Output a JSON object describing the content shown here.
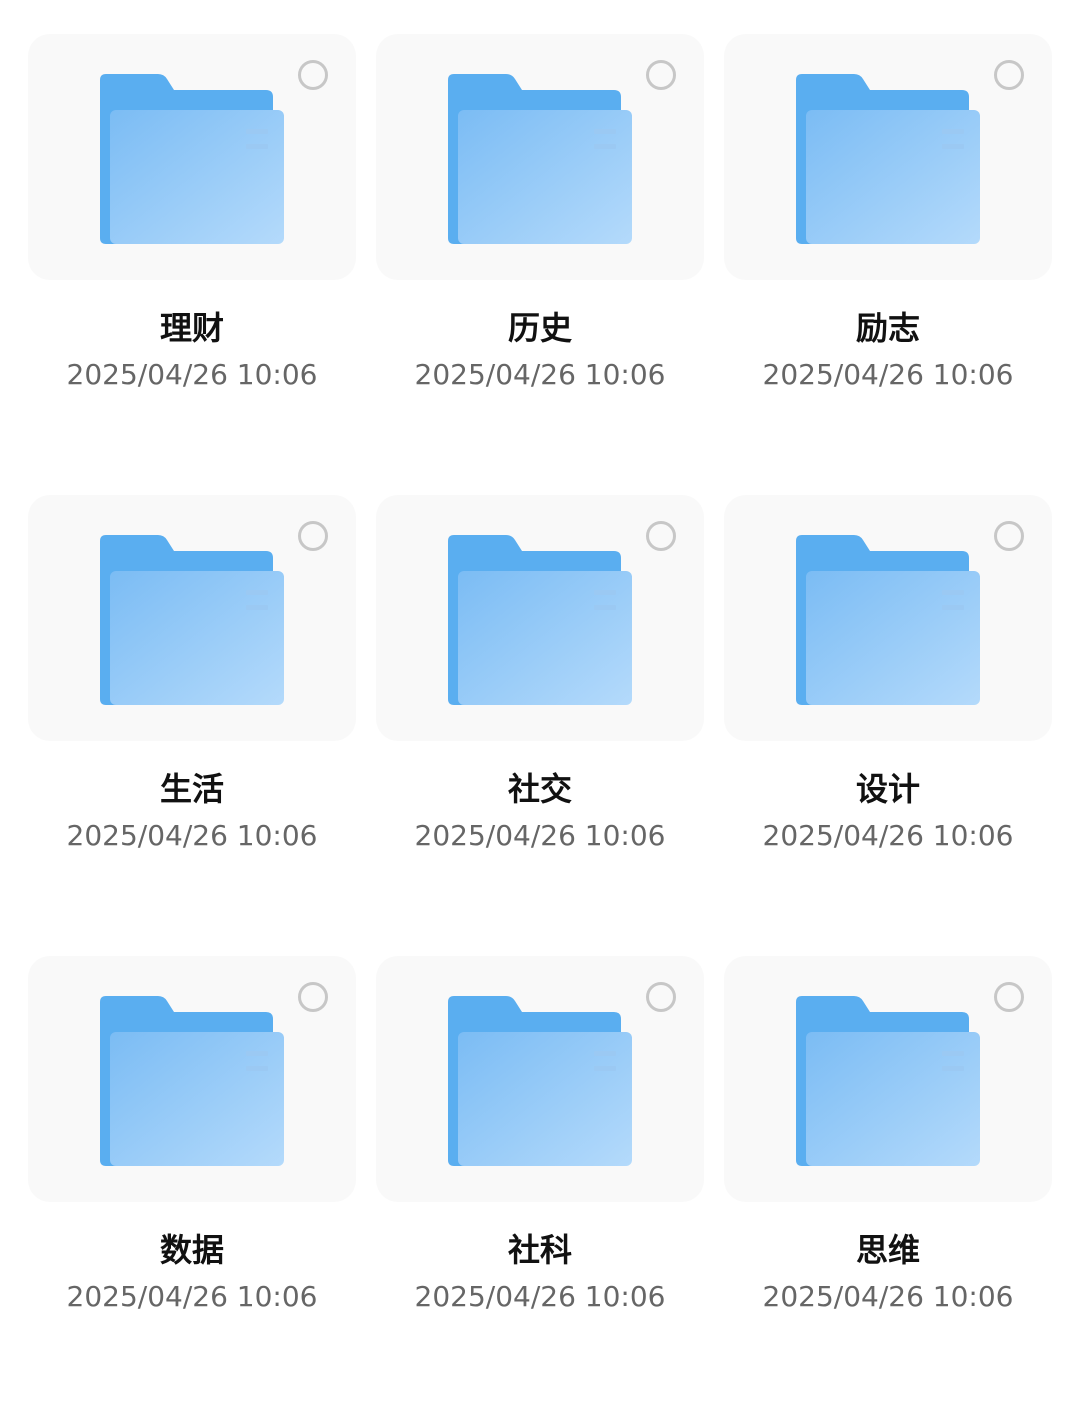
{
  "colors": {
    "folder_back": "#5aaef0",
    "folder_front_start": "#7bbcf4",
    "folder_front_end": "#b4dafb",
    "folder_lines": "#9bc9f3",
    "card_bg": "#f9f9f9",
    "circle_border": "#c7c7c7"
  },
  "icons": {
    "folder": "folder-icon",
    "select": "select-circle-icon"
  },
  "folders": [
    {
      "name": "理财",
      "date": "2025/04/26 10:06"
    },
    {
      "name": "历史",
      "date": "2025/04/26 10:06"
    },
    {
      "name": "励志",
      "date": "2025/04/26 10:06"
    },
    {
      "name": "生活",
      "date": "2025/04/26 10:06"
    },
    {
      "name": "社交",
      "date": "2025/04/26 10:06"
    },
    {
      "name": "设计",
      "date": "2025/04/26 10:06"
    },
    {
      "name": "数据",
      "date": "2025/04/26 10:06"
    },
    {
      "name": "社科",
      "date": "2025/04/26 10:06"
    },
    {
      "name": "思维",
      "date": "2025/04/26 10:06"
    }
  ]
}
